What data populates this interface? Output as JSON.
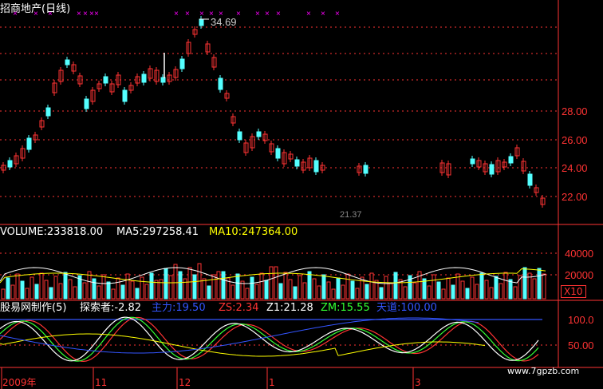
{
  "title": "招商地产(日线)",
  "price_panel": {
    "peak_label": "34.69",
    "low_label": "21.37",
    "y_ticks": [
      "28.00",
      "26.00",
      "24.00",
      "22.00"
    ]
  },
  "volume_panel": {
    "volume": "VOLUME:233818.00",
    "ma5": "MA5:297258.41",
    "ma10": "MA10:247364.00",
    "y_ticks": [
      "40000",
      "20000"
    ],
    "unit": "X10"
  },
  "indicator_panel": {
    "name": "股易网制作(5)",
    "explorer": "探索者:-2.82",
    "main_force": "主力:19.50",
    "zs": "ZS:2.34",
    "z1": "Z1:21.28",
    "zm": "ZM:15.55",
    "tiandi": "天道:100.00",
    "y_ticks": [
      "100.0",
      "50.00"
    ]
  },
  "x_axis": {
    "labels": [
      "2009年",
      "11",
      "12",
      "1",
      "3"
    ]
  },
  "watermark": "www.7gpzb.com",
  "colors": {
    "up": "#ff3333",
    "down": "#54ffff",
    "ma5": "#ffffff",
    "ma10": "#ffff00",
    "axis": "#ff3333",
    "signal": "#ff00ff"
  }
}
